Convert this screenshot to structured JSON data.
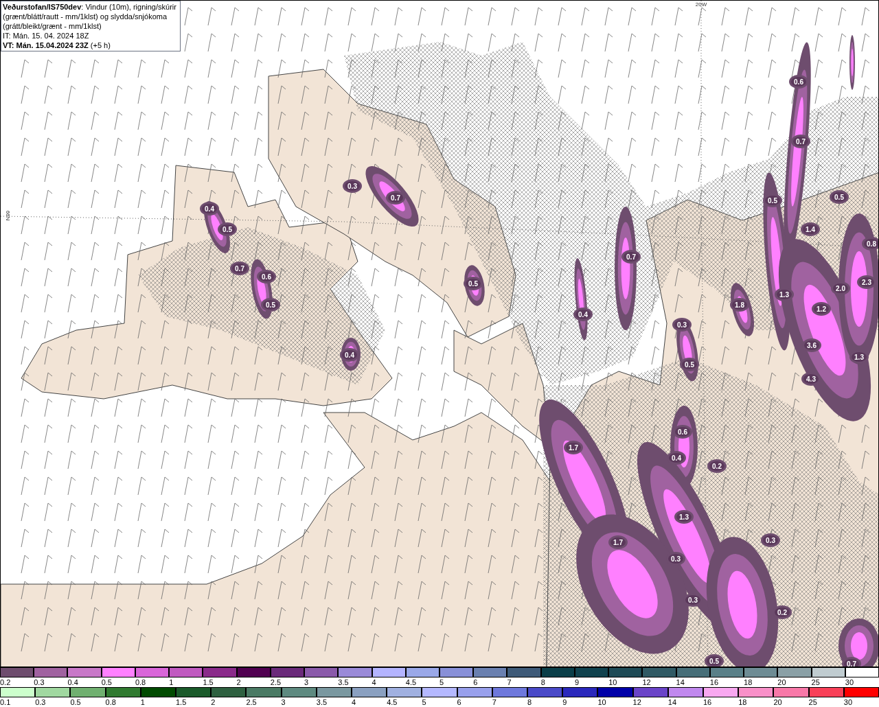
{
  "header": {
    "description": "**Veðurstofan/IS750dev**: Vindur (10m), rigning/skúrir (grænt/blátt/rautt - mm/1klst) og slydda/snjókoma (grátt/bleikt/grænt - mm/1klst)",
    "issue_time": "IT: Mán. 15. 04. 2024 18Z",
    "valid_time": "**VT: Mán. 15.04.2024 23Z** (+5 h)"
  },
  "grid_labels": [
    "20W",
    "66N"
  ],
  "map_labels": [
    "0.4",
    "0.5",
    "0.7",
    "0.6",
    "0.5",
    "0.3",
    "0.7",
    "0.5",
    "0.4",
    "0.7",
    "0.4",
    "0.3",
    "0.5",
    "1.8",
    "0.6",
    "0.7",
    "0.5",
    "0.5",
    "1.4",
    "0.8",
    "1.3",
    "1.2",
    "2.0",
    "2.3",
    "3.6",
    "4.3",
    "1.3",
    "1.7",
    "0.6",
    "0.4",
    "0.2",
    "1.3",
    "1.7",
    "0.3",
    "0.3",
    "0.3",
    "0.2",
    "0.5",
    "0.7"
  ],
  "legend": {
    "snow": [
      {
        "label": "0.2",
        "color": "#6e4d6e"
      },
      {
        "label": "0.3",
        "color": "#a062a0"
      },
      {
        "label": "0.4",
        "color": "#c878c8"
      },
      {
        "label": "0.5",
        "color": "#ff80ff"
      },
      {
        "label": "0.8",
        "color": "#d966d9"
      },
      {
        "label": "1",
        "color": "#c05ac0"
      },
      {
        "label": "1.5",
        "color": "#8a2a8a"
      },
      {
        "label": "2",
        "color": "#500050"
      },
      {
        "label": "2.5",
        "color": "#6a2a7a"
      },
      {
        "label": "3",
        "color": "#8a5aaa"
      },
      {
        "label": "3.5",
        "color": "#9a8ad8"
      },
      {
        "label": "4",
        "color": "#b4b4ff"
      },
      {
        "label": "4.5",
        "color": "#9aa8e8"
      },
      {
        "label": "5",
        "color": "#8890d8"
      },
      {
        "label": "6",
        "color": "#6a80b0"
      },
      {
        "label": "7",
        "color": "#3e5a78"
      },
      {
        "label": "8",
        "color": "#0a3e48"
      },
      {
        "label": "9",
        "color": "#10424e"
      },
      {
        "label": "10",
        "color": "#1e4a56"
      },
      {
        "label": "12",
        "color": "#305a64"
      },
      {
        "label": "14",
        "color": "#466e78"
      },
      {
        "label": "16",
        "color": "#5a8088"
      },
      {
        "label": "18",
        "color": "#6e8c94"
      },
      {
        "label": "20",
        "color": "#8aa0a6"
      },
      {
        "label": "25",
        "color": "#c0ccd0"
      },
      {
        "label": "30",
        "color": "#ffffff"
      }
    ],
    "rain": [
      {
        "label": "0.1",
        "color": "#ccffcc"
      },
      {
        "label": "0.3",
        "color": "#a0d8a0"
      },
      {
        "label": "0.5",
        "color": "#70b070"
      },
      {
        "label": "0.8",
        "color": "#307a30"
      },
      {
        "label": "1",
        "color": "#004a00"
      },
      {
        "label": "1.5",
        "color": "#1a5a2a"
      },
      {
        "label": "2",
        "color": "#2e6040"
      },
      {
        "label": "2.5",
        "color": "#4a7a64"
      },
      {
        "label": "3",
        "color": "#5e8a80"
      },
      {
        "label": "3.5",
        "color": "#7a98a0"
      },
      {
        "label": "4",
        "color": "#8aa0c0"
      },
      {
        "label": "4.5",
        "color": "#a0b0e0"
      },
      {
        "label": "5",
        "color": "#b4b8ff"
      },
      {
        "label": "6",
        "color": "#98a0ec"
      },
      {
        "label": "7",
        "color": "#6e78dc"
      },
      {
        "label": "8",
        "color": "#4a4ac8"
      },
      {
        "label": "9",
        "color": "#2a28bc"
      },
      {
        "label": "10",
        "color": "#0000a8"
      },
      {
        "label": "12",
        "color": "#6a44c8"
      },
      {
        "label": "14",
        "color": "#c088ee"
      },
      {
        "label": "16",
        "color": "#f8a8f0"
      },
      {
        "label": "18",
        "color": "#f890c8"
      },
      {
        "label": "20",
        "color": "#f878a8"
      },
      {
        "label": "25",
        "color": "#f84058"
      },
      {
        "label": "30",
        "color": "#ff0000"
      }
    ]
  }
}
